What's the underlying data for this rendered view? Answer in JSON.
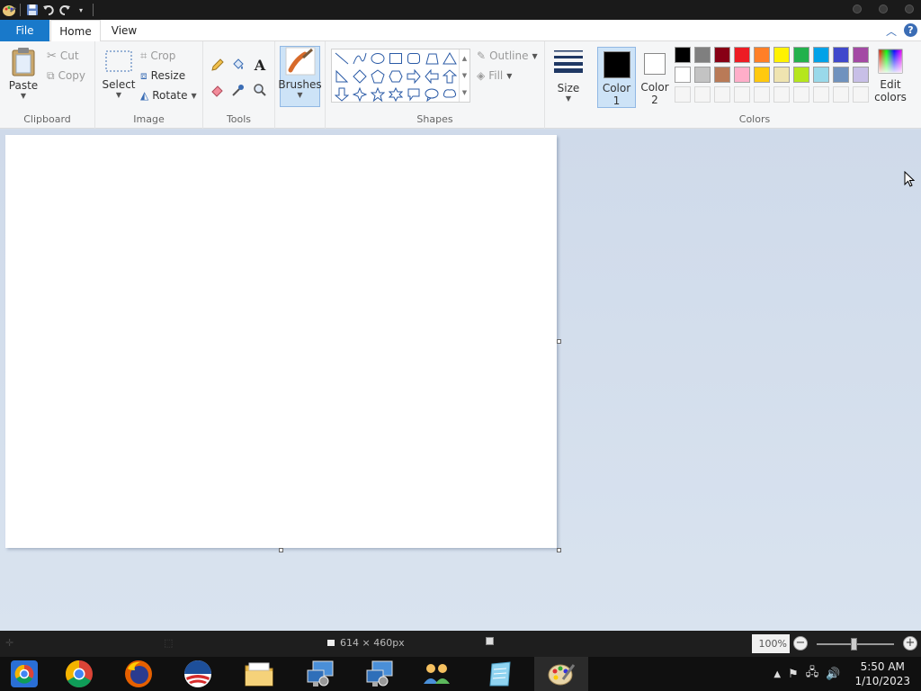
{
  "ribbon_tabs": {
    "file": "File",
    "home": "Home",
    "view": "View"
  },
  "clipboard": {
    "paste": "Paste",
    "cut": "Cut",
    "copy": "Copy",
    "label": "Clipboard"
  },
  "image": {
    "select": "Select",
    "crop": "Crop",
    "resize": "Resize",
    "rotate": "Rotate",
    "label": "Image"
  },
  "tools": {
    "label": "Tools"
  },
  "brushes": {
    "label": "Brushes"
  },
  "shapes": {
    "outline": "Outline",
    "fill": "Fill",
    "label": "Shapes"
  },
  "size": {
    "label": "Size"
  },
  "colors": {
    "color1": "Color",
    "color1_num": "1",
    "color2": "Color",
    "color2_num": "2",
    "edit": "Edit",
    "edit2": "colors",
    "label": "Colors",
    "color1_value": "#000000",
    "color2_value": "#ffffff",
    "palette_row1": [
      "#000000",
      "#7f7f7f",
      "#880015",
      "#ed1c24",
      "#ff7f27",
      "#fff200",
      "#22b14c",
      "#00a2e8",
      "#3f48cc",
      "#a349a4"
    ],
    "palette_row2": [
      "#ffffff",
      "#c3c3c3",
      "#b97a57",
      "#ffaec9",
      "#ffc90e",
      "#efe4b0",
      "#b5e61d",
      "#99d9ea",
      "#7092be",
      "#c8bfe7"
    ],
    "palette_row3": [
      "#f5f5f5",
      "#f5f5f5",
      "#f5f5f5",
      "#f5f5f5",
      "#f5f5f5",
      "#f5f5f5",
      "#f5f5f5",
      "#f5f5f5",
      "#f5f5f5",
      "#f5f5f5"
    ]
  },
  "status": {
    "canvas_size": "614 × 460px",
    "zoom": "100%"
  },
  "tray": {
    "time": "5:50 AM",
    "date": "1/10/2023"
  }
}
